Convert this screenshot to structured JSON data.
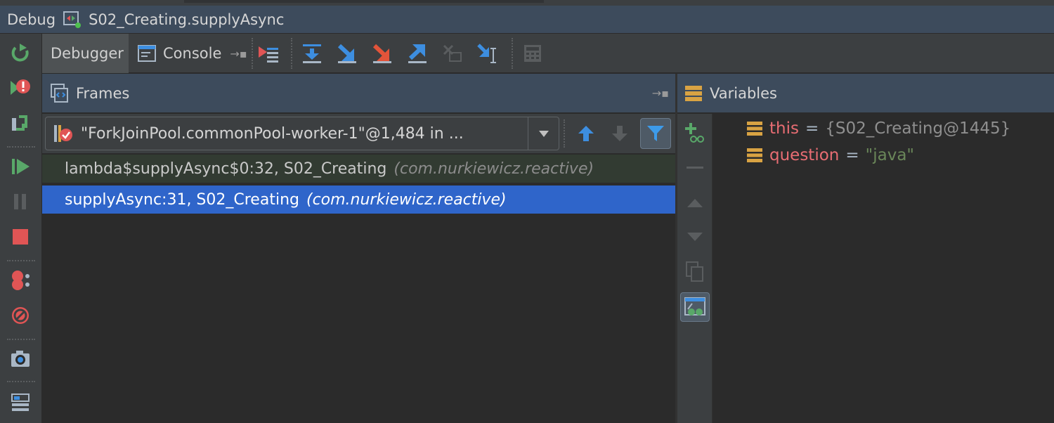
{
  "title_bar": {
    "label": "Debug",
    "config_name": "S02_Creating.supplyAsync",
    "config_icon": "run-config-icon"
  },
  "left_toolbar": [
    {
      "name": "rerun-icon",
      "tooltip": "Rerun"
    },
    {
      "name": "restart-exception-icon",
      "tooltip": "Restart"
    },
    {
      "name": "update-app-icon",
      "tooltip": "Update"
    },
    {
      "name": "resume-icon",
      "tooltip": "Resume Program"
    },
    {
      "name": "pause-icon",
      "tooltip": "Pause Program"
    },
    {
      "name": "stop-icon",
      "tooltip": "Stop"
    },
    {
      "name": "view-breakpoints-icon",
      "tooltip": "View Breakpoints"
    },
    {
      "name": "mute-breakpoints-icon",
      "tooltip": "Mute Breakpoints"
    },
    {
      "name": "camera-icon",
      "tooltip": "Get Thread Dump"
    },
    {
      "name": "layout-icon",
      "tooltip": "Restore Layout"
    }
  ],
  "tabs": [
    {
      "label": "Debugger",
      "active": true
    },
    {
      "label": "Console",
      "active": false
    }
  ],
  "debug_toolbar": [
    "show-execution-point-icon",
    "step-over-icon",
    "step-into-icon",
    "force-step-into-icon",
    "step-out-icon",
    "drop-frame-icon",
    "run-to-cursor-icon",
    "evaluate-expression-icon"
  ],
  "frames": {
    "title": "Frames",
    "thread": "\"ForkJoinPool.commonPool-worker-1\"@1,484 in ...",
    "rows": [
      {
        "name": "lambda$supplyAsync$0:32, S02_Creating",
        "package": "(com.nurkiewicz.reactive)",
        "selected": false
      },
      {
        "name": "supplyAsync:31, S02_Creating",
        "package": "(com.nurkiewicz.reactive)",
        "selected": true
      }
    ]
  },
  "variables": {
    "title": "Variables",
    "items": [
      {
        "name": "this",
        "eq": "=",
        "value": "{S02_Creating@1445}"
      },
      {
        "name": "question",
        "eq": "=",
        "value": "\"java\""
      }
    ]
  },
  "colors": {
    "accent_selection": "#2f65ca",
    "header_bg": "#3d4b5c",
    "panel_bg": "#3c3f41",
    "var_name": "#e86d73",
    "string_value": "#6a8759"
  }
}
